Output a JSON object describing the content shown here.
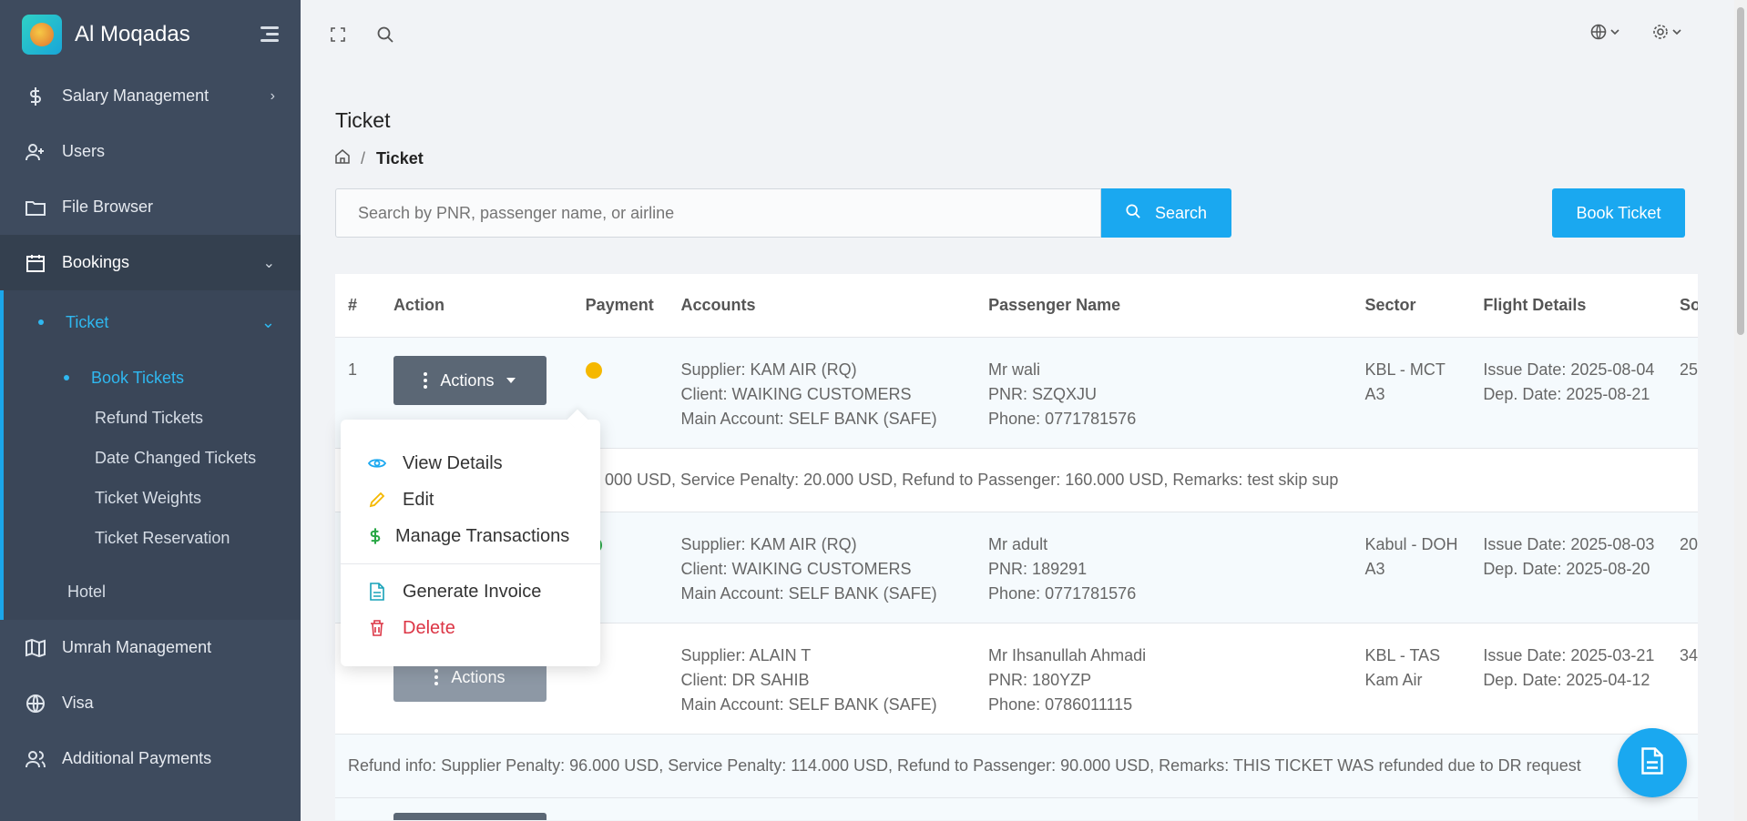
{
  "brand": {
    "name": "Al Moqadas"
  },
  "sidebar": {
    "items": [
      {
        "label": "Salary Management",
        "icon": "dollar-icon"
      },
      {
        "label": "Users",
        "icon": "user-plus-icon"
      },
      {
        "label": "File Browser",
        "icon": "folder-icon"
      },
      {
        "label": "Bookings",
        "icon": "calendar-icon"
      }
    ],
    "ticket": {
      "label": "Ticket"
    },
    "ticket_sub": [
      "Book Tickets",
      "Refund Tickets",
      "Date Changed Tickets",
      "Ticket Weights",
      "Ticket Reservation"
    ],
    "hotel": {
      "label": "Hotel"
    },
    "after": [
      {
        "label": "Umrah Management",
        "icon": "map-icon"
      },
      {
        "label": "Visa",
        "icon": "globe-icon"
      },
      {
        "label": "Additional Payments",
        "icon": "users-icon"
      }
    ]
  },
  "page": {
    "title": "Ticket",
    "breadcrumb_current": "Ticket",
    "search_placeholder": "Search by PNR, passenger name, or airline",
    "search_label": "Search",
    "book_label": "Book Ticket"
  },
  "table": {
    "headers": [
      "#",
      "Action",
      "Payment",
      "Accounts",
      "Passenger Name",
      "Sector",
      "Flight Details",
      "So"
    ],
    "actions_label": "Actions",
    "rows": [
      {
        "num": "1",
        "payment_color": "#f5b800",
        "acc": [
          "Supplier: KAM AIR (RQ)",
          "Client: WAIKING CUSTOMERS",
          "Main Account: SELF BANK (SAFE)"
        ],
        "pas": [
          "Mr wali",
          "PNR: SZQXJU",
          "Phone: 0771781576"
        ],
        "sec": [
          "KBL - MCT",
          "A3"
        ],
        "fli": [
          "Issue Date: 2025-08-04",
          "Dep. Date: 2025-08-21"
        ],
        "so": "25",
        "info": "000 USD, Service Penalty: 20.000 USD, Refund to Passenger: 160.000 USD, Remarks: test skip sup"
      },
      {
        "num": "",
        "payment_color": "#28a745",
        "acc": [
          "Supplier: KAM AIR (RQ)",
          "Client: WAIKING CUSTOMERS",
          "Main Account: SELF BANK (SAFE)"
        ],
        "pas": [
          "Mr adult",
          "PNR: 189291",
          "Phone: 0771781576"
        ],
        "sec": [
          "Kabul - DOH",
          "A3"
        ],
        "fli": [
          "Issue Date: 2025-08-03",
          "Dep. Date: 2025-08-20"
        ],
        "so": "20"
      },
      {
        "num": "",
        "payment_color": "#28a745",
        "acc": [
          "Supplier: ALAIN T",
          "Client: DR SAHIB",
          "Main Account: SELF BANK (SAFE)"
        ],
        "pas": [
          "Mr Ihsanullah Ahmadi",
          "PNR: 180YZP",
          "Phone: 0786011115"
        ],
        "sec": [
          "KBL - TAS",
          "Kam Air"
        ],
        "fli": [
          "Issue Date: 2025-03-21",
          "Dep. Date: 2025-04-12"
        ],
        "so": "34",
        "info": "Refund info: Supplier Penalty: 96.000 USD, Service Penalty: 114.000 USD, Refund to Passenger: 90.000 USD, Remarks: THIS TICKET WAS refunded due to DR request"
      }
    ]
  },
  "dropdown": {
    "items": [
      {
        "label": "View Details",
        "icon": "eye-icon",
        "color": "#1aa8f0"
      },
      {
        "label": "Edit",
        "icon": "pencil-icon",
        "color": "#f5b800"
      },
      {
        "label": "Manage Transactions",
        "icon": "dollar-icon",
        "color": "#28a745"
      },
      {
        "label": "Generate Invoice",
        "icon": "file-icon",
        "color": "#17a2b8"
      },
      {
        "label": "Delete",
        "icon": "trash-icon",
        "color": "#dc3545"
      }
    ]
  }
}
